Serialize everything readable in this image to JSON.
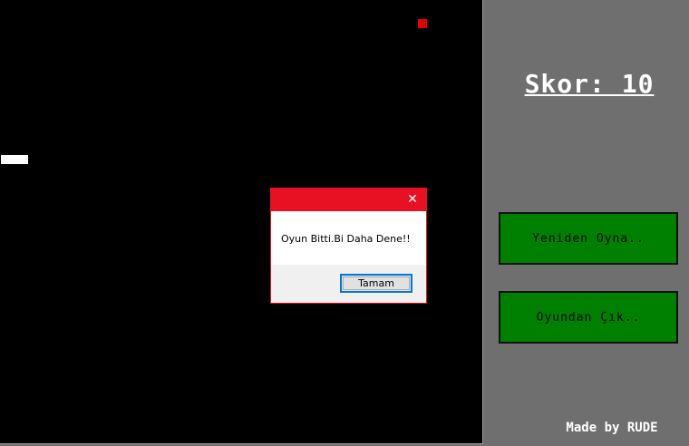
{
  "game": {
    "board_color": "#000000",
    "food_color": "#e00000",
    "snake_color": "#ffffff"
  },
  "panel": {
    "background": "#6f6f6f",
    "score_text": "Skor: 10",
    "restart_label": "Yeniden Oyna..",
    "quit_label": "Oyundan Çık..",
    "button_color": "#008000",
    "credit": "Made by RUDE"
  },
  "dialog": {
    "accent_color": "#e81123",
    "close_icon": "close-icon",
    "close_glyph": "✕",
    "message": "Oyun Bitti.Bi Daha Dene!!",
    "ok_label": "Tamam"
  }
}
